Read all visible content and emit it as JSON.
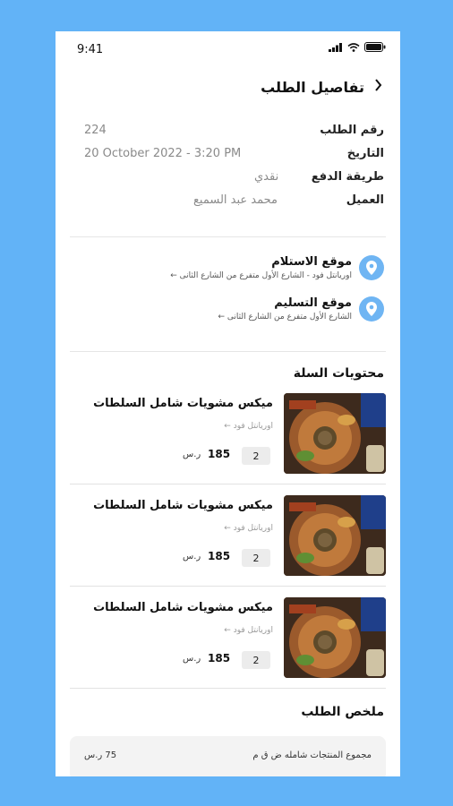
{
  "status": {
    "time": "9:41"
  },
  "header": {
    "title": "تفاصيل الطلب",
    "back_icon": "chevron-left-icon"
  },
  "order": {
    "rows": [
      {
        "label": "رقم الطلب",
        "value": "224"
      },
      {
        "label": "التاريخ",
        "value": "20 October 2022 - 3:20 PM"
      },
      {
        "label": "طريقة الدفع",
        "value": "نقدي"
      },
      {
        "label": "العميل",
        "value": "محمد عبد السميع"
      }
    ]
  },
  "locations": [
    {
      "title": "موقع الاستلام",
      "address": "اوريانتل فود - الشارع الأول متفرع من الشارع الثانى ←"
    },
    {
      "title": "موقع التسليم",
      "address": "الشارع الأول متفرع من الشارع الثانى ←"
    }
  ],
  "cart": {
    "title": "محتويات السلة",
    "items": [
      {
        "name": "ميكس مشويات شامل السلطات",
        "brand": "اوريانتل فود ←",
        "qty": "2",
        "price": "185",
        "currency": "ر.س"
      },
      {
        "name": "ميكس مشويات شامل السلطات",
        "brand": "اوريانتل فود ←",
        "qty": "2",
        "price": "185",
        "currency": "ر.س"
      },
      {
        "name": "ميكس مشويات شامل السلطات",
        "brand": "اوريانتل فود ←",
        "qty": "2",
        "price": "185",
        "currency": "ر.س"
      }
    ]
  },
  "summary": {
    "title": "ملخص الطلب",
    "label": "مجموع المنتجات شامله ض ق م",
    "value": "75 ر.س"
  },
  "colors": {
    "accent": "#6fb5f3",
    "background": "#62b3f7"
  }
}
